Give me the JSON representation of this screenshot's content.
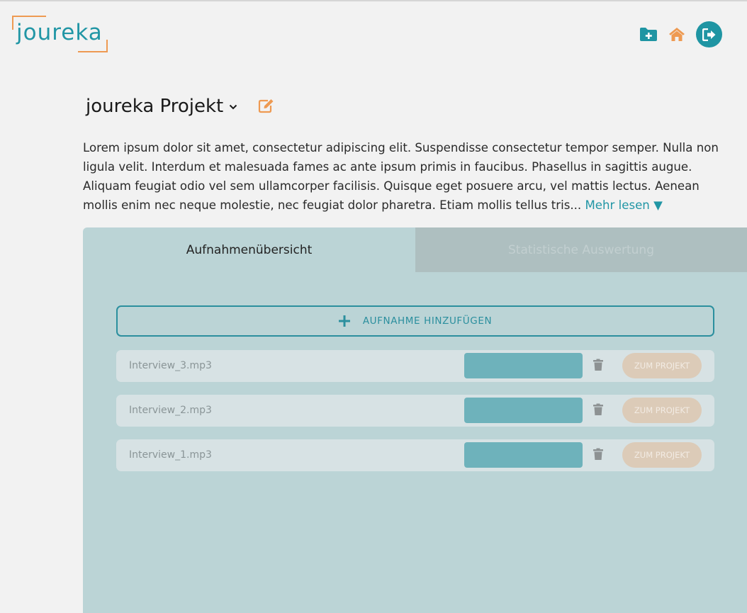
{
  "header": {
    "logo_text": "joureka",
    "icons": [
      "add-folder-icon",
      "home-icon",
      "logout-icon"
    ],
    "colors": {
      "teal": "#1f95a3",
      "orange": "#ee9a52"
    }
  },
  "project": {
    "title": "joureka Projekt",
    "description": "Lorem ipsum dolor sit amet, consectetur adipiscing elit. Suspendisse consectetur tempor semper. Nulla non ligula velit. Interdum et malesuada fames ac ante ipsum primis in faucibus. Phasellus in sagittis augue. Aliquam feugiat odio vel sem ullamcorper facilisis. Quisque eget posuere arcu, vel mattis lectus. Aenean mollis enim nec neque molestie, nec feugiat dolor pharetra. Etiam mollis tellus tris...",
    "more_label": "Mehr lesen ▼"
  },
  "tabs": [
    {
      "label": "Aufnahmenübersicht",
      "active": true
    },
    {
      "label": "Statistische Auswertung",
      "active": false
    }
  ],
  "add_recording_label": "AUFNAHME HINZUFÜGEN",
  "recordings": [
    {
      "name": "Interview_3.mp3",
      "action_label": "ZUM PROJEKT"
    },
    {
      "name": "Interview_2.mp3",
      "action_label": "ZUM PROJEKT"
    },
    {
      "name": "Interview_1.mp3",
      "action_label": "ZUM PROJEKT"
    }
  ]
}
